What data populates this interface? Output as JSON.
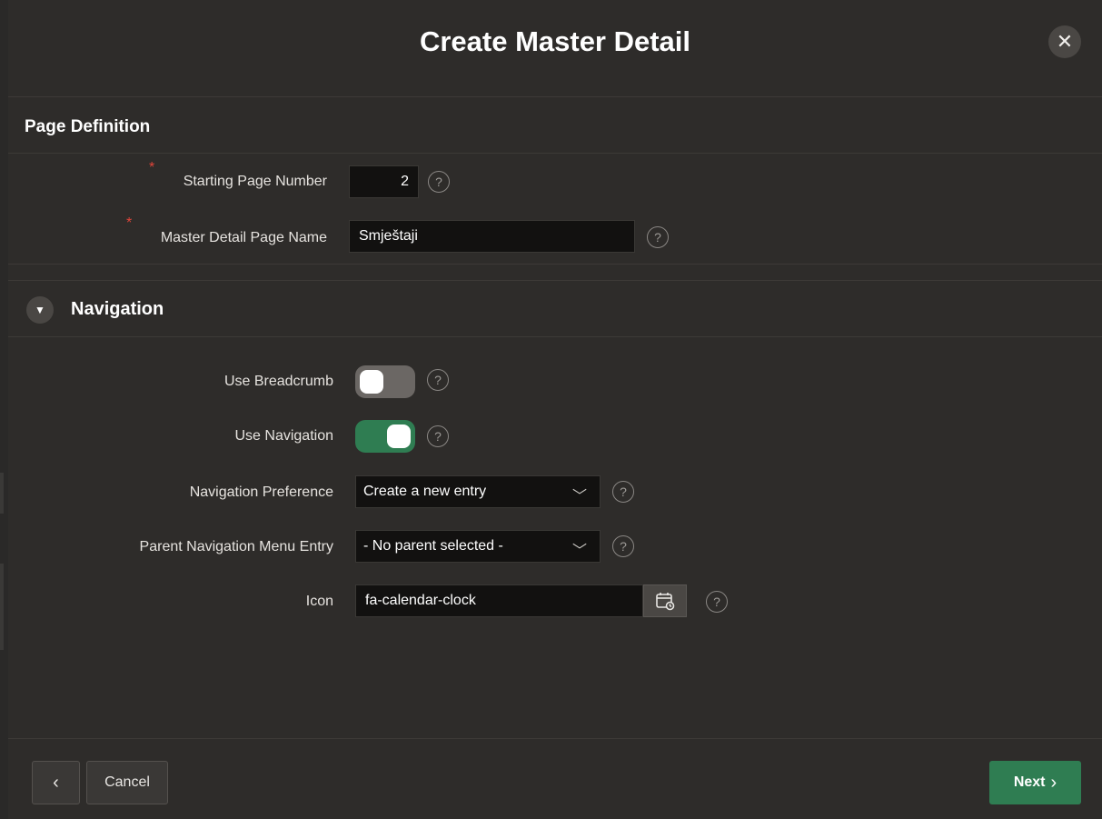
{
  "dialog": {
    "title": "Create Master Detail",
    "close_icon": "close-icon"
  },
  "page_definition": {
    "title": "Page Definition",
    "starting_page_number": {
      "label": "Starting Page Number",
      "value": "2",
      "required": true
    },
    "master_detail_page_name": {
      "label": "Master Detail Page Name",
      "value": "Smještaji",
      "required": true
    }
  },
  "navigation": {
    "title": "Navigation",
    "use_breadcrumb": {
      "label": "Use Breadcrumb",
      "on": false
    },
    "use_navigation": {
      "label": "Use Navigation",
      "on": true
    },
    "navigation_preference": {
      "label": "Navigation Preference",
      "value": "Create a new entry"
    },
    "parent_navigation_menu_entry": {
      "label": "Parent Navigation Menu Entry",
      "value": "- No parent selected -"
    },
    "icon": {
      "label": "Icon",
      "value": "fa-calendar-clock",
      "picker_icon": "calendar-clock-icon"
    }
  },
  "footer": {
    "back_icon": "chevron-left-icon",
    "cancel_label": "Cancel",
    "next_label": "Next",
    "next_icon": "chevron-right-icon"
  },
  "colors": {
    "accent_green": "#2f7d52",
    "required_red": "#e0453a",
    "dialog_bg": "#2e2c2a",
    "input_bg": "#121110"
  }
}
